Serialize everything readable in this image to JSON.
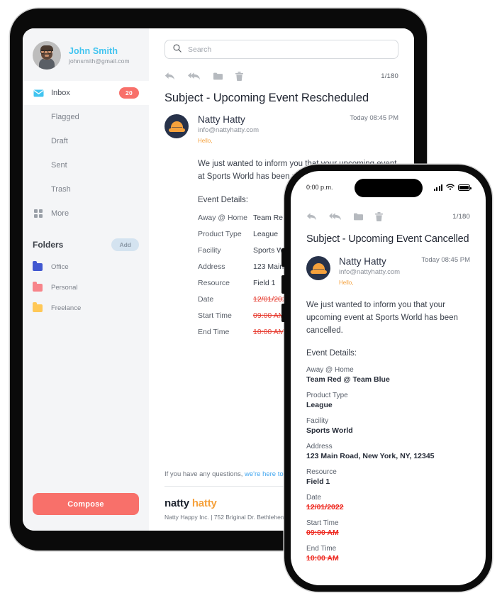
{
  "sidebar": {
    "profile": {
      "name": "John Smith",
      "email": "johnsmith@gmail.com",
      "avatar_icon": "user-avatar-photo"
    },
    "nav": [
      {
        "label": "Inbox",
        "badge": "20",
        "icon": "envelope-icon",
        "active": true
      },
      {
        "label": "Flagged",
        "badge": "",
        "icon": "",
        "active": false
      },
      {
        "label": "Draft",
        "badge": "",
        "icon": "",
        "active": false
      },
      {
        "label": "Sent",
        "badge": "",
        "icon": "",
        "active": false
      },
      {
        "label": "Trash",
        "badge": "",
        "icon": "",
        "active": false
      },
      {
        "label": "More",
        "badge": "",
        "icon": "grid-icon",
        "active": false
      }
    ],
    "folders_title": "Folders",
    "add_label": "Add",
    "folders": [
      {
        "label": "Office",
        "color": "#4158d0"
      },
      {
        "label": "Personal",
        "color": "#f7848a"
      },
      {
        "label": "Freelance",
        "color": "#ffc857"
      }
    ],
    "compose_label": "Compose"
  },
  "tablet": {
    "search_placeholder": "Search",
    "toolbar": {
      "reply": "reply-icon",
      "reply_all": "reply-all-icon",
      "archive": "folder-icon",
      "delete": "trash-icon",
      "counter": "1/180"
    },
    "subject": "Subject - Upcoming Event Rescheduled",
    "sender_name": "Natty Hatty",
    "sender_email": "info@nattyhatty.com",
    "greeting": "Hello,",
    "timestamp": "Today 08:45 PM",
    "body": "We just wanted to inform you that your upcoming event at Sports World has been rescheduled.",
    "event_details_label": "Event Details:",
    "event_rows": [
      {
        "key": "Away @ Home",
        "value": "Team Red @ Team Blue",
        "struck": false
      },
      {
        "key": "Product Type",
        "value": "League",
        "struck": false
      },
      {
        "key": "Facility",
        "value": "Sports World",
        "struck": false
      },
      {
        "key": "Address",
        "value": "123 Main Road, New York, NY, 12345",
        "struck": false
      },
      {
        "key": "Resource",
        "value": "Field 1",
        "struck": false
      },
      {
        "key": "Date",
        "value": "12/01/2022",
        "struck": true
      },
      {
        "key": "Start Time",
        "value": "09:00 AM",
        "struck": true
      },
      {
        "key": "End Time",
        "value": "10:00 AM",
        "struck": true
      }
    ],
    "footnote_prefix": "If you have any questions, ",
    "footnote_link": "we're here to help",
    "brand_first": "natty",
    "brand_second": "hatty",
    "footer_address": "Natty Happy Inc. | 752 Briginal Dr. Bethlehem, PA"
  },
  "phone": {
    "status_time": "0:00 p.m.",
    "status_icons": {
      "signal": "signal-bars-icon",
      "wifi": "wifi-icon",
      "battery": "battery-icon"
    },
    "toolbar": {
      "reply": "reply-icon",
      "reply_all": "reply-all-icon",
      "archive": "folder-icon",
      "delete": "trash-icon",
      "counter": "1/180"
    },
    "subject": "Subject - Upcoming Event Cancelled",
    "sender_name": "Natty Hatty",
    "sender_email": "info@nattyhatty.com",
    "greeting": "Hello,",
    "timestamp": "Today 08:45 PM",
    "body": "We just wanted to inform you that your upcoming event at Sports World has been cancelled.",
    "event_details_label": "Event Details:",
    "event_rows": [
      {
        "key": "Away @ Home",
        "value": "Team Red @ Team Blue",
        "struck": false
      },
      {
        "key": "Product Type",
        "value": "League",
        "struck": false
      },
      {
        "key": "Facility",
        "value": "Sports World",
        "struck": false
      },
      {
        "key": "Address",
        "value": "123 Main Road, New York, NY, 12345",
        "struck": false
      },
      {
        "key": "Resource",
        "value": "Field 1",
        "struck": false
      },
      {
        "key": "Date",
        "value": "12/01/2022",
        "struck": true
      },
      {
        "key": "Start Time",
        "value": "09:00 AM",
        "struck": true
      },
      {
        "key": "End Time",
        "value": "10:00 AM",
        "struck": true
      }
    ]
  },
  "colors": {
    "accent_red": "#f8706a",
    "accent_blue": "#41c4f0",
    "brand_orange": "#f5a13c",
    "strike_red": "#e63a2e",
    "sidebar_bg": "#f4f5f7"
  }
}
